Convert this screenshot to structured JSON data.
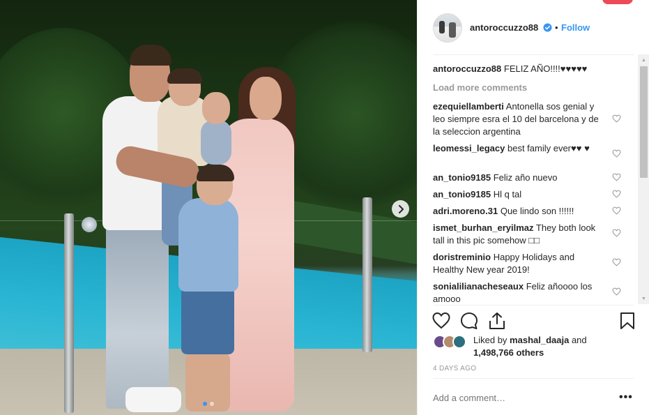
{
  "post": {
    "username": "antoroccuzzo88",
    "separator": "•",
    "follow_label": "Follow",
    "verified": true,
    "carousel": {
      "total_slides": 2,
      "active_slide": 1
    }
  },
  "comments": {
    "caption": {
      "user": "antoroccuzzo88",
      "text": "FELIZ AÑO!!!!♥♥♥♥♥"
    },
    "load_more_label": "Load more comments",
    "items": [
      {
        "user": "ezequiellamberti",
        "text": "Antonella sos genial y leo siempre esra el 10 del barcelona y de la seleccion argentina"
      },
      {
        "user": "leomessi_legacy",
        "text": "best family ever♥♥ ♥"
      },
      {
        "user": "an_tonio9185",
        "text": "Feliz año nuevo"
      },
      {
        "user": "an_tonio9185",
        "text": "Hl q tal"
      },
      {
        "user": "adri.moreno.31",
        "text": "Que lindo son !!!!!!"
      },
      {
        "user": "ismet_burhan_eryilmaz",
        "text": "They both look tall in this pic somehow □□"
      },
      {
        "user": "doristreminio",
        "text": "Happy Holidays and Healthy New year 2019!"
      },
      {
        "user": "sonialilianacheseaux",
        "text": "Feliz añoooo los amooo"
      }
    ]
  },
  "likes": {
    "prefix": "Liked by",
    "user": "mashal_daaja",
    "joiner": "and",
    "count": "1,498,766 others"
  },
  "timestamp": "4 DAYS AGO",
  "add_comment": {
    "placeholder": "Add a comment…",
    "more_label": "•••"
  },
  "colors": {
    "link": "#3897f0",
    "muted": "#999999",
    "text": "#262626",
    "notification": "#ed4956"
  }
}
